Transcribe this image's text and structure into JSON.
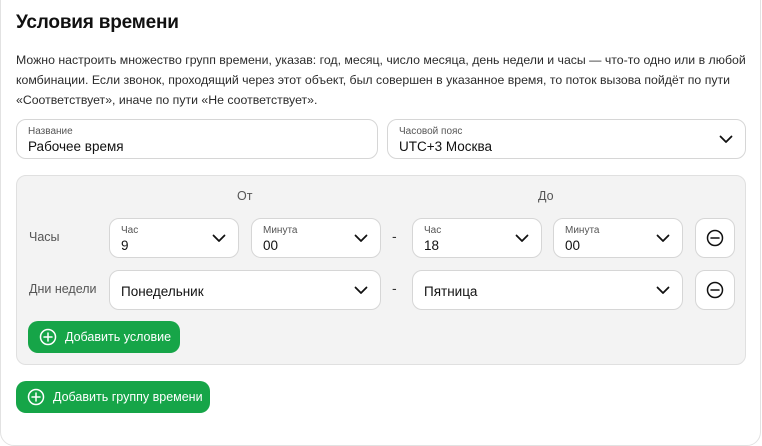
{
  "header": {
    "title": "Условия времени",
    "description": "Можно настроить множество групп времени, указав: год, месяц, число месяца, день недели и часы — что-то одно или в любой комбинации. Если звонок, проходящий через этот объект, был совершен в указанное время, то поток вызова пойдёт по пути «Соответствует», иначе по пути «Не соответствует»."
  },
  "name_field": {
    "label": "Название",
    "value": "Рабочее время"
  },
  "timezone_field": {
    "label": "Часовой пояс",
    "value": "UTC+3 Москва"
  },
  "group": {
    "from_label": "От",
    "to_label": "До",
    "dash": "-",
    "hours_row": {
      "label": "Часы",
      "from_hour": {
        "label": "Час",
        "value": "9"
      },
      "from_minute": {
        "label": "Минута",
        "value": "00"
      },
      "to_hour": {
        "label": "Час",
        "value": "18"
      },
      "to_minute": {
        "label": "Минута",
        "value": "00"
      }
    },
    "weekdays_row": {
      "label": "Дни недели",
      "from_day": {
        "value": "Понедельник"
      },
      "to_day": {
        "value": "Пятница"
      }
    },
    "add_condition_label": "Добавить условие"
  },
  "add_group_label": "Добавить группу времени",
  "colors": {
    "accent": "#16a548",
    "border": "#d6d6d6",
    "group_bg": "#f3f3f3"
  },
  "icons": [
    "chevron-down-icon",
    "minus-circle-icon",
    "plus-circle-icon"
  ]
}
